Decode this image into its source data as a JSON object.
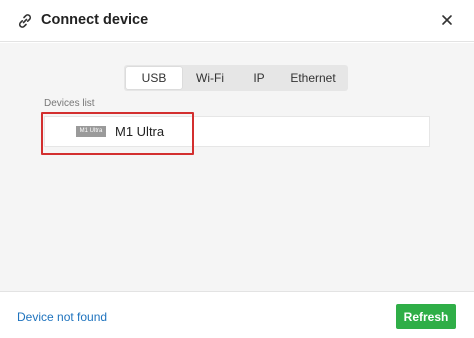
{
  "dialog": {
    "title": "Connect device",
    "title_icon": "link-icon",
    "close_icon": "close-icon"
  },
  "tabs": [
    {
      "label": "USB",
      "active": true
    },
    {
      "label": "Wi-Fi",
      "active": false
    },
    {
      "label": "IP",
      "active": false
    },
    {
      "label": "Ethernet",
      "active": false
    }
  ],
  "devices": {
    "label": "Devices list",
    "items": [
      {
        "thumb_label": "M1 Ultra",
        "name": "M1 Ultra"
      }
    ]
  },
  "footer": {
    "not_found_link": "Device not found",
    "refresh_label": "Refresh"
  },
  "colors": {
    "accent_green": "#2fae47",
    "link_blue": "#1e73be",
    "highlight_red": "#d32f2f"
  }
}
